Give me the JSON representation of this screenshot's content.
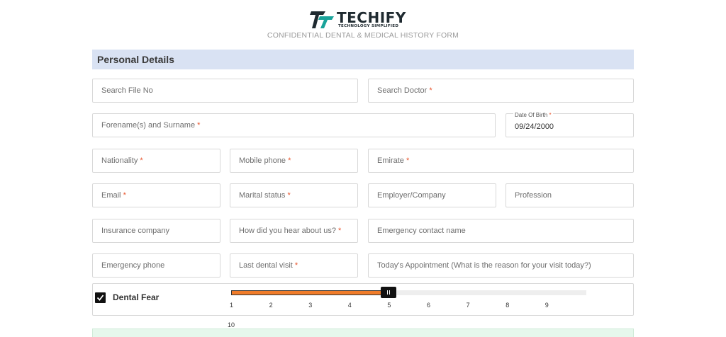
{
  "brand": {
    "name": "TECHIFY",
    "tagline": "TECHNOLOGY SIMPLIFIED",
    "logo_icon": "tt-logo-icon"
  },
  "form": {
    "title": "CONFIDENTIAL DENTAL & MEDICAL HISTORY FORM"
  },
  "section": {
    "title": "Personal Details"
  },
  "fields": {
    "search_file_no": {
      "placeholder": "Search File No",
      "required": false
    },
    "search_doctor": {
      "placeholder": "Search Doctor",
      "required": true
    },
    "full_name": {
      "placeholder": "Forename(s) and Surname",
      "required": true
    },
    "date_of_birth": {
      "label": "Date Of Birth",
      "required": true,
      "value": "09/24/2000"
    },
    "nationality": {
      "placeholder": "Nationality",
      "required": true
    },
    "mobile_phone": {
      "placeholder": "Mobile phone",
      "required": true
    },
    "emirate": {
      "placeholder": "Emirate",
      "required": true
    },
    "email": {
      "placeholder": "Email",
      "required": true
    },
    "marital_status": {
      "placeholder": "Marital status",
      "required": true
    },
    "employer": {
      "placeholder": "Employer/Company",
      "required": false
    },
    "profession": {
      "placeholder": "Profession",
      "required": false
    },
    "insurance": {
      "placeholder": "Insurance company",
      "required": false
    },
    "referral": {
      "placeholder": "How did you hear about us?",
      "required": true
    },
    "emergency_name": {
      "placeholder": "Emergency contact name",
      "required": false
    },
    "emergency_phone": {
      "placeholder": "Emergency phone",
      "required": false
    },
    "last_dental_visit": {
      "placeholder": "Last dental visit",
      "required": true
    },
    "appointment_reason": {
      "placeholder": "Today's Appointment (What is the reason for your visit today?)",
      "required": false
    }
  },
  "required_marker": "*",
  "dental_fear": {
    "label": "Dental Fear",
    "checked": true,
    "slider_min": 1,
    "slider_max": 10,
    "slider_value": 5,
    "ticks": [
      "1",
      "2",
      "3",
      "4",
      "5",
      "6",
      "7",
      "8",
      "9",
      "10"
    ]
  },
  "colors": {
    "section_header_bg": "#d9e2f3",
    "required": "#e8542c",
    "slider_fill": "#f07c2a",
    "next_section_bg": "#e6f7ec"
  }
}
